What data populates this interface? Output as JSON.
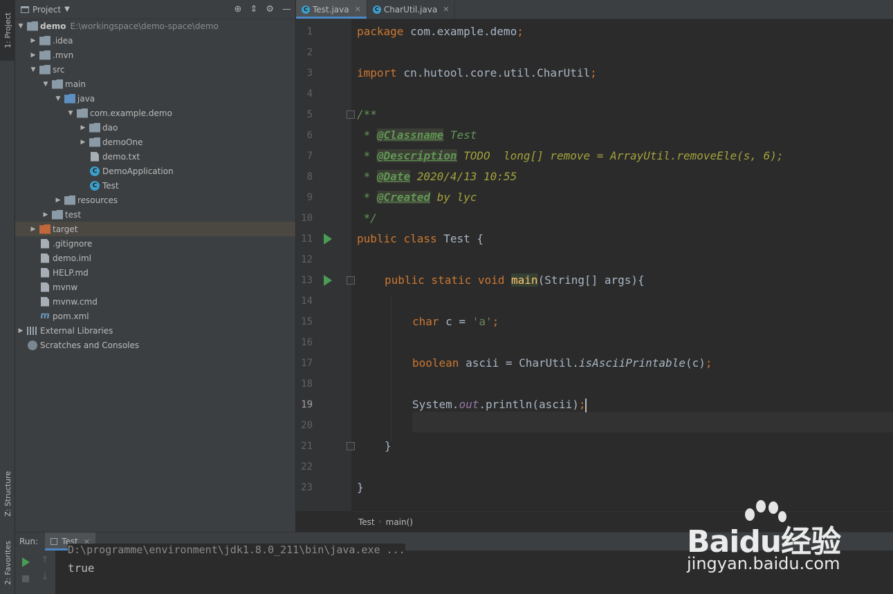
{
  "sidebar_tabs": {
    "project": "1: Project",
    "structure": "Z: Structure",
    "favorites": "2: Favorites"
  },
  "project_panel": {
    "title": "Project",
    "tree": [
      {
        "label": "demo",
        "path": "E:\\workingspace\\demo-space\\demo",
        "indent": 0,
        "arrow": "open",
        "icon": "module"
      },
      {
        "label": ".idea",
        "indent": 1,
        "arrow": "closed",
        "icon": "folder"
      },
      {
        "label": ".mvn",
        "indent": 1,
        "arrow": "closed",
        "icon": "folder"
      },
      {
        "label": "src",
        "indent": 1,
        "arrow": "open",
        "icon": "folder"
      },
      {
        "label": "main",
        "indent": 2,
        "arrow": "open",
        "icon": "folder"
      },
      {
        "label": "java",
        "indent": 3,
        "arrow": "open",
        "icon": "folder-blue"
      },
      {
        "label": "com.example.demo",
        "indent": 4,
        "arrow": "open",
        "icon": "package"
      },
      {
        "label": "dao",
        "indent": 5,
        "arrow": "closed",
        "icon": "package"
      },
      {
        "label": "demoOne",
        "indent": 5,
        "arrow": "closed",
        "icon": "package"
      },
      {
        "label": "demo.txt",
        "indent": 5,
        "arrow": "none",
        "icon": "file"
      },
      {
        "label": "DemoApplication",
        "indent": 5,
        "arrow": "none",
        "icon": "class"
      },
      {
        "label": "Test",
        "indent": 5,
        "arrow": "none",
        "icon": "class"
      },
      {
        "label": "resources",
        "indent": 3,
        "arrow": "closed",
        "icon": "folder"
      },
      {
        "label": "test",
        "indent": 2,
        "arrow": "closed",
        "icon": "folder"
      },
      {
        "label": "target",
        "indent": 1,
        "arrow": "closed",
        "icon": "folder-orange",
        "selected": true
      },
      {
        "label": ".gitignore",
        "indent": 1,
        "arrow": "none",
        "icon": "file"
      },
      {
        "label": "demo.iml",
        "indent": 1,
        "arrow": "none",
        "icon": "file"
      },
      {
        "label": "HELP.md",
        "indent": 1,
        "arrow": "none",
        "icon": "file"
      },
      {
        "label": "mvnw",
        "indent": 1,
        "arrow": "none",
        "icon": "file"
      },
      {
        "label": "mvnw.cmd",
        "indent": 1,
        "arrow": "none",
        "icon": "file"
      },
      {
        "label": "pom.xml",
        "indent": 1,
        "arrow": "none",
        "icon": "maven"
      },
      {
        "label": "External Libraries",
        "indent": 0,
        "arrow": "closed",
        "icon": "library"
      },
      {
        "label": "Scratches and Consoles",
        "indent": 0,
        "arrow": "none",
        "icon": "scratch"
      }
    ]
  },
  "editor": {
    "tabs": [
      {
        "label": "Test.java",
        "active": true
      },
      {
        "label": "CharUtil.java",
        "active": false
      }
    ],
    "current_line": 19,
    "line_numbers": [
      "1",
      "2",
      "3",
      "4",
      "5",
      "6",
      "7",
      "8",
      "9",
      "10",
      "11",
      "12",
      "13",
      "14",
      "15",
      "16",
      "17",
      "18",
      "19",
      "20",
      "21",
      "22",
      "23"
    ],
    "code": {
      "l1_kw": "package",
      "l1_rest": " com.example.demo",
      "l1_semi": ";",
      "l3_kw": "import",
      "l3_rest": " cn.hutool.core.util.CharUtil",
      "l3_semi": ";",
      "l5": "/**",
      "l6_pre": " * ",
      "l6_tag": "@Classname",
      "l6_rest": " Test",
      "l7_pre": " * ",
      "l7_tag": "@Description",
      "l7_rest": " TODO  long[] remove = ArrayUtil.removeEle(s, 6);",
      "l8_pre": " * ",
      "l8_tag": "@Date",
      "l8_rest": " 2020/4/13 10:55",
      "l9_pre": " * ",
      "l9_tag": "@Created",
      "l9_rest": " by lyc",
      "l10": " */",
      "l11_kw": "public class",
      "l11_rest": " Test {",
      "l13_kw": "public static void",
      "l13_fn": "main",
      "l13_rest": "(String[] args){",
      "l15_kw": "char",
      "l15_rest": " c = ",
      "l15_str": "'a'",
      "l15_semi": ";",
      "l17_kw": "boolean",
      "l17_rest": " ascii = CharUtil.",
      "l17_static": "isAsciiPrintable",
      "l17_args": "(c)",
      "l17_semi": ";",
      "l19_pre": "System.",
      "l19_out": "out",
      "l19_rest": ".println(ascii)",
      "l19_semi": ";",
      "l21": "}",
      "l23": "}"
    },
    "breadcrumb": [
      "Test",
      "main()"
    ]
  },
  "run_panel": {
    "label": "Run:",
    "tab": "Test",
    "command": "D:\\programme\\environment\\jdk1.8.0_211\\bin\\java.exe ...",
    "output": "true"
  },
  "watermark": {
    "brand_left": "Bai",
    "brand_du": "du",
    "brand_right": "经验",
    "url": "jingyan.baidu.com"
  }
}
